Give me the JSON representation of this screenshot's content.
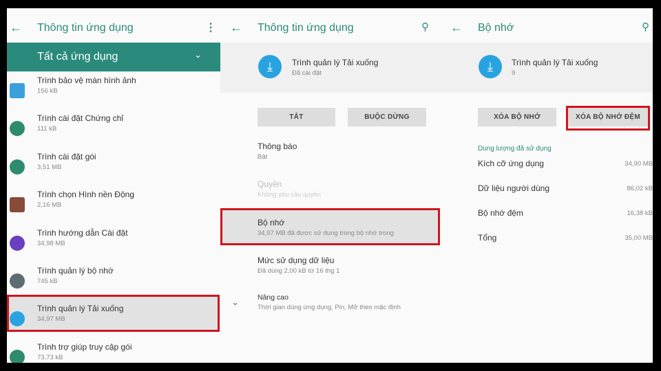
{
  "panel1": {
    "title": "Thông tin ứng dụng",
    "filter": "Tất cả ứng dụng",
    "apps": [
      {
        "name": "Trình bảo vệ màn hình ảnh",
        "size": "156 kB",
        "icon": "screensaver-icon",
        "color": "#3aa0dc"
      },
      {
        "name": "Trình cài đặt Chứng chỉ",
        "size": "111 kB",
        "icon": "android-icon",
        "color": "#2e8b6e"
      },
      {
        "name": "Trình cài đặt gói",
        "size": "3,51 MB",
        "icon": "android-icon",
        "color": "#2e8b6e"
      },
      {
        "name": "Trình chọn Hình nền Động",
        "size": "2,16 MB",
        "icon": "wallpaper-icon",
        "color": "#8a4a3a"
      },
      {
        "name": "Trình hướng dẫn Cài đặt",
        "size": "34,98 MB",
        "icon": "setup-wizard-icon",
        "color": "#6a3fc0"
      },
      {
        "name": "Trình quản lý bộ nhớ",
        "size": "745 kB",
        "icon": "storage-manager-icon",
        "color": "#5f6b72"
      },
      {
        "name": "Trình quản lý Tải xuống",
        "size": "34,97 MB",
        "icon": "download-icon",
        "color": "#29a3e0"
      },
      {
        "name": "Trình trợ giúp truy cập gói",
        "size": "73,73 kB",
        "icon": "android-icon",
        "color": "#2e8b6e"
      }
    ]
  },
  "panel2": {
    "title": "Thông tin ứng dụng",
    "app_name": "Trình quản lý Tải xuống",
    "app_status": "Đã cài đặt",
    "btn_disable": "TẮT",
    "btn_force_stop": "BUỘC DỪNG",
    "items": [
      {
        "title": "Thông báo",
        "sub": "Bật"
      },
      {
        "title": "Quyền",
        "sub": "Không yêu cầu quyền"
      },
      {
        "title": "Bộ nhớ",
        "sub": "34,97 MB đã được sử dụng trong bộ nhớ trong"
      },
      {
        "title": "Mức sử dụng dữ liệu",
        "sub": "Đã dùng 2,00 kB từ 16 thg 1"
      },
      {
        "title": "Nâng cao",
        "sub": "Thời gian dùng ứng dụng, Pin, Mở theo mặc định"
      }
    ]
  },
  "panel3": {
    "title": "Bộ nhớ",
    "app_name": "Trình quản lý Tải xuống",
    "app_sub": "9",
    "btn_clear_storage": "XÓA BỘ NHỚ",
    "btn_clear_cache": "XÓA BỘ NHỚ ĐỆM",
    "section": "Dung lượng đã sử dụng",
    "rows": [
      {
        "label": "Kích cỡ ứng dụng",
        "value": "34,90 MB"
      },
      {
        "label": "Dữ liệu người dùng",
        "value": "86,02 kB"
      },
      {
        "label": "Bộ nhớ đệm",
        "value": "16,38 kB"
      },
      {
        "label": "Tổng",
        "value": "35,00 MB"
      }
    ]
  },
  "colors": {
    "accent": "#2a8a7c",
    "highlight": "#d0141e",
    "download": "#29a3e0"
  }
}
